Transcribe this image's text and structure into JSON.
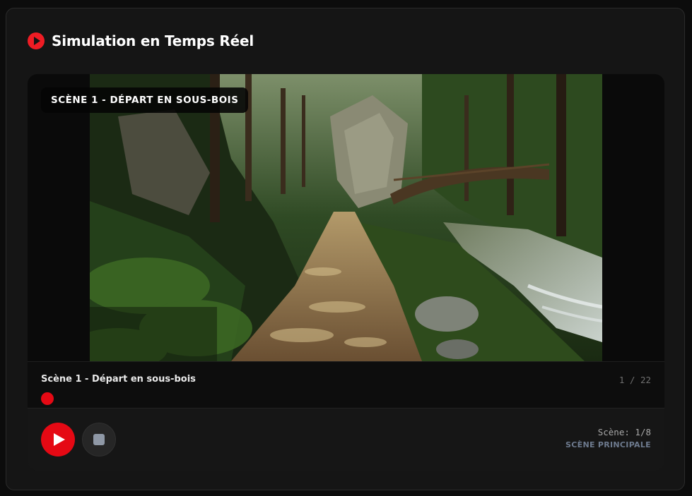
{
  "header": {
    "title": "Simulation en Temps Réel",
    "icon": "play-circle-icon"
  },
  "player": {
    "badge": "SCÈNE 1 - DÉPART EN SOUS-BOIS",
    "scene_name": "Scène 1 - Départ en sous-bois",
    "counter": "1 / 22",
    "progress_text": "Scène: 1/8",
    "scene_type": "SCÈNE PRINCIPALE"
  },
  "colors": {
    "accent": "#e50914",
    "background": "#151515",
    "panel_border": "#2b2b2b"
  }
}
